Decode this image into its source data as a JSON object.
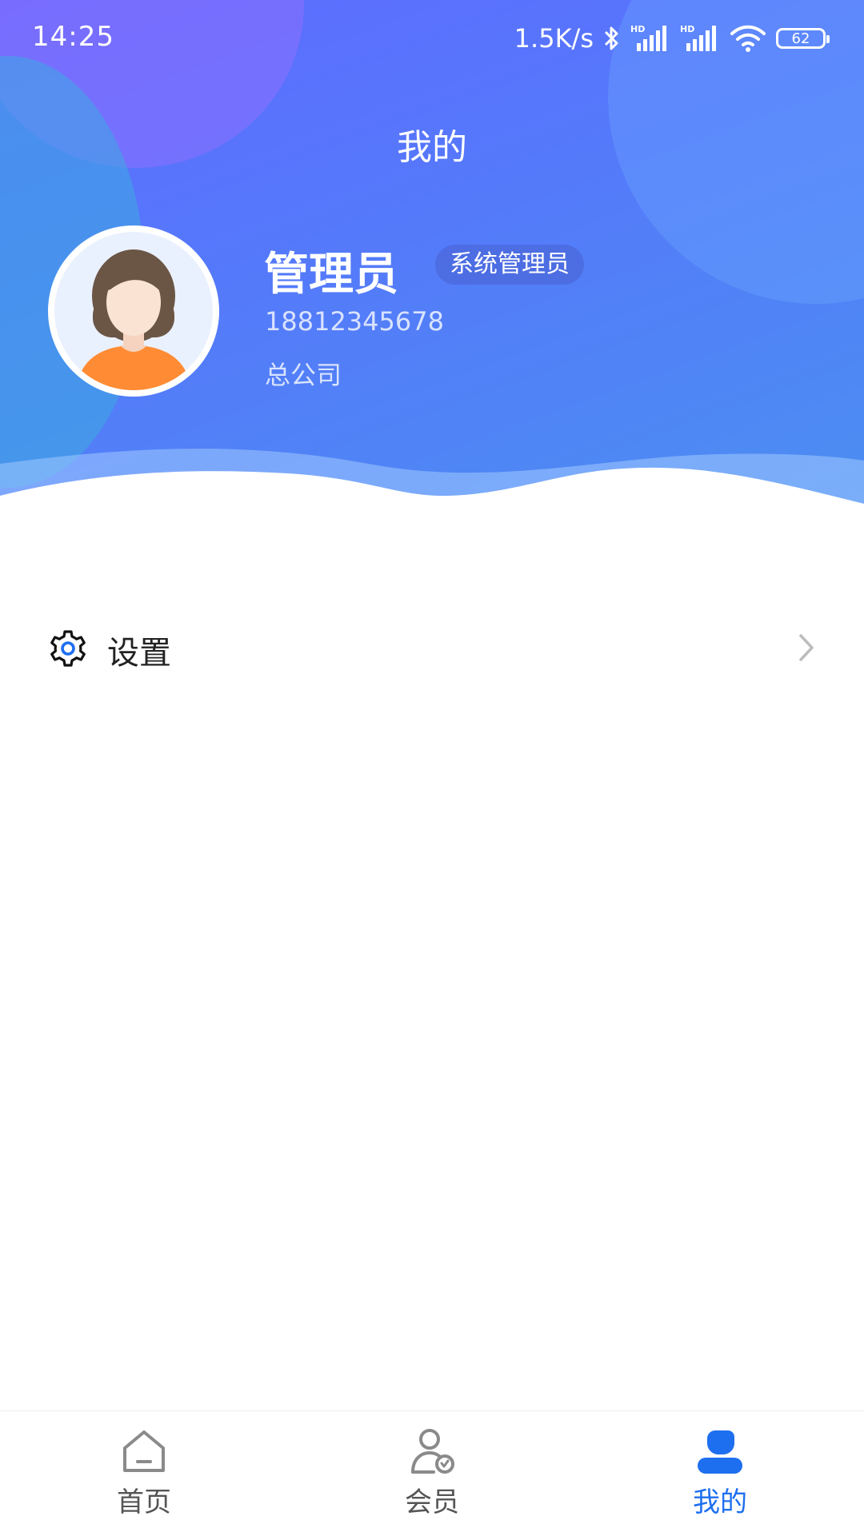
{
  "status_bar": {
    "time": "14:25",
    "network_speed": "1.5K/s",
    "battery": "62"
  },
  "header": {
    "title": "我的"
  },
  "profile": {
    "name": "管理员",
    "role": "系统管理员",
    "phone": "18812345678",
    "company": "总公司"
  },
  "menu": {
    "items": [
      {
        "label": "设置",
        "icon": "gear-icon"
      }
    ]
  },
  "bottom_nav": {
    "items": [
      {
        "label": "首页",
        "icon": "home-icon",
        "active": false
      },
      {
        "label": "会员",
        "icon": "member-icon",
        "active": false
      },
      {
        "label": "我的",
        "icon": "user-icon",
        "active": true
      }
    ]
  },
  "colors": {
    "accent": "#1e6ff0",
    "header_gradient_start": "#5f6bff",
    "header_gradient_end": "#4b8ff1"
  }
}
